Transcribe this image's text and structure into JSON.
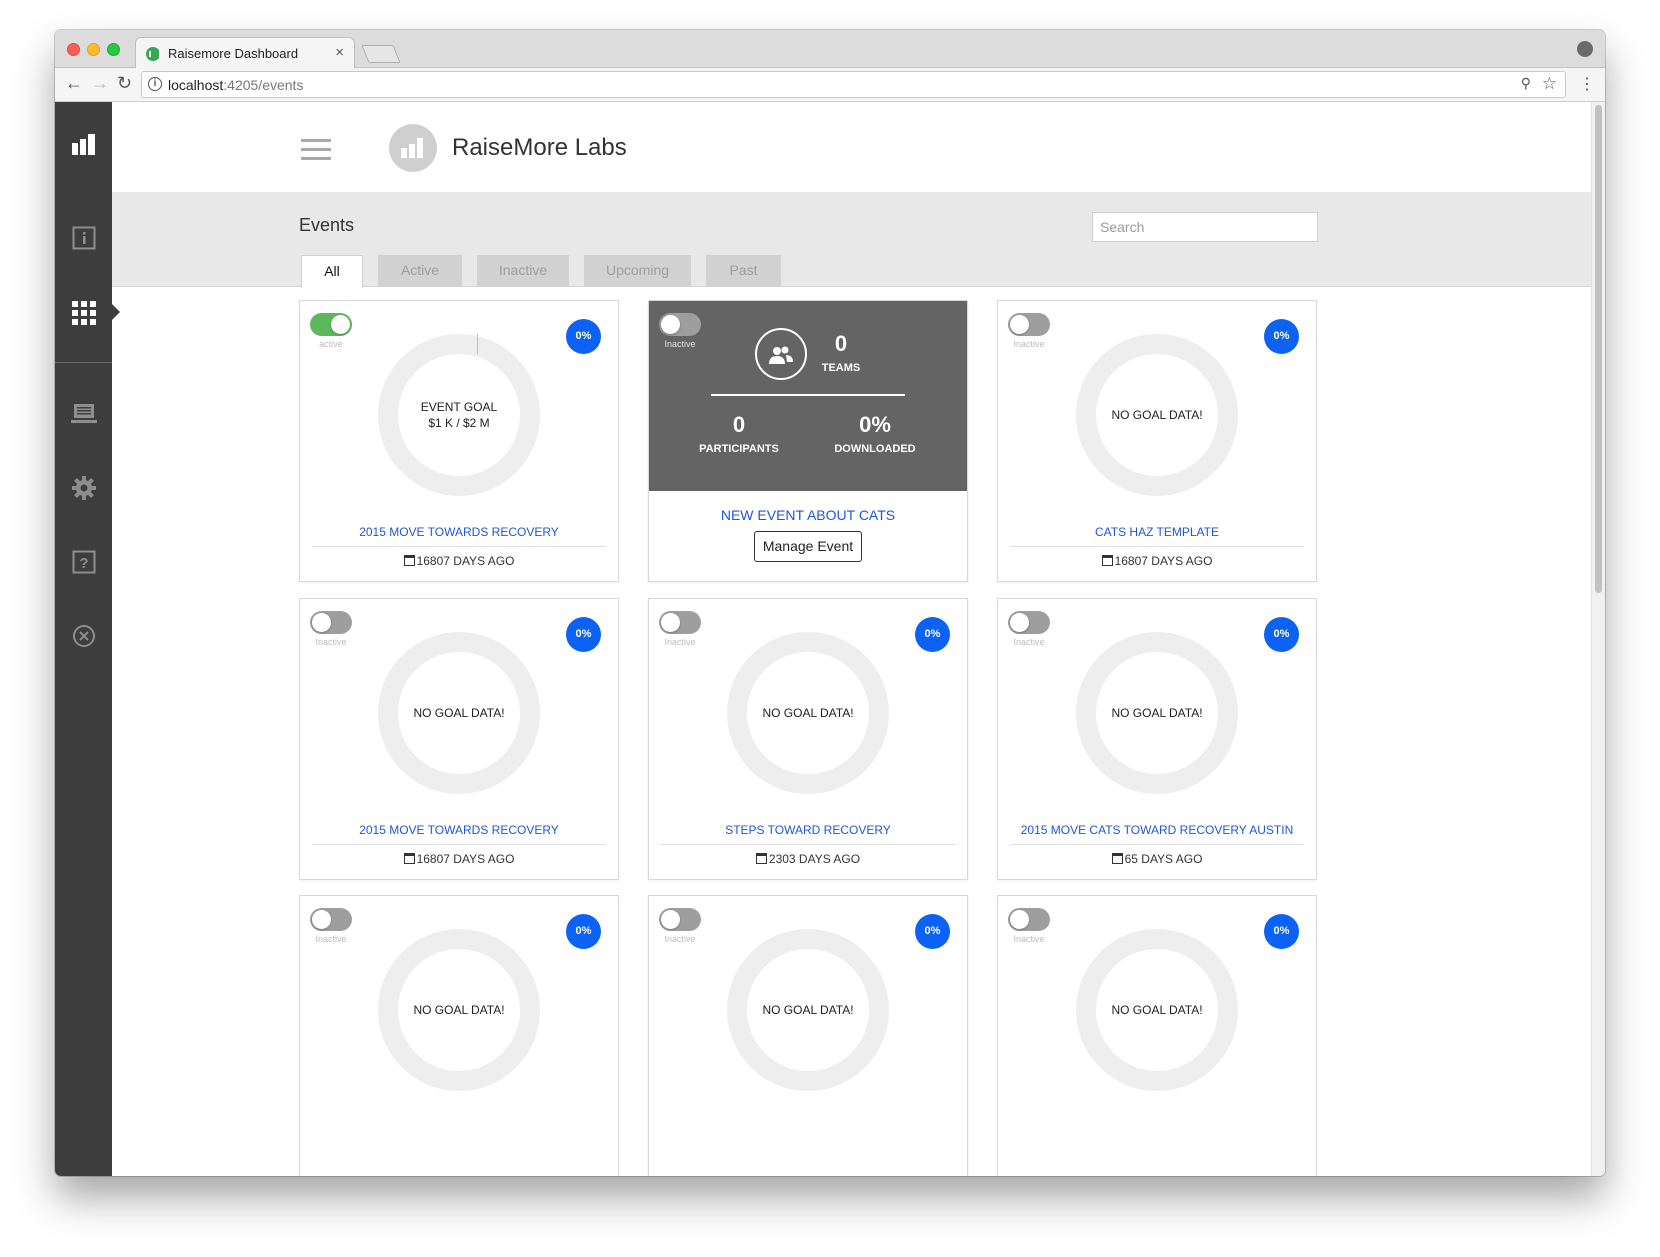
{
  "browser": {
    "tab_title": "Raisemore Dashboard",
    "tab_close": "×",
    "url_host": "localhost",
    "url_path": ":4205/events"
  },
  "header": {
    "brand": "RaiseMore Labs"
  },
  "page": {
    "title": "Events",
    "search_placeholder": "Search"
  },
  "filter_tabs": [
    "All",
    "Active",
    "Inactive",
    "Upcoming",
    "Past"
  ],
  "sidebar_icons": [
    "bar-chart-icon",
    "info-icon",
    "apps-grid-icon",
    "laptop-icon",
    "gear-icon",
    "help-icon",
    "close-circle-icon"
  ],
  "featured": {
    "teams_num": "0",
    "teams_label": "TEAMS",
    "participants_num": "0",
    "participants_label": "PARTICIPANTS",
    "downloaded_num": "0%",
    "downloaded_label": "DOWNLOADED",
    "event_name": "NEW EVENT ABOUT CATS",
    "manage_label": "Manage Event",
    "status": "Inactive"
  },
  "cards": [
    {
      "status": "active",
      "badge": "0%",
      "goal_line1": "EVENT GOAL",
      "goal_line2": "$1 K / $2 M",
      "name": "2015 MOVE TOWARDS RECOVERY",
      "days": "16807 DAYS AGO",
      "progress": 0.0005
    },
    {
      "status": "Inactive",
      "badge": "0%",
      "goal_line1": "NO GOAL DATA!",
      "goal_line2": "",
      "name": "CATS HAZ TEMPLATE",
      "days": "16807 DAYS AGO"
    },
    {
      "status": "Inactive",
      "badge": "0%",
      "goal_line1": "NO GOAL DATA!",
      "goal_line2": "",
      "name": "2015 MOVE TOWARDS RECOVERY",
      "days": "16807 DAYS AGO"
    },
    {
      "status": "Inactive",
      "badge": "0%",
      "goal_line1": "NO GOAL DATA!",
      "goal_line2": "",
      "name": "STEPS TOWARD RECOVERY",
      "days": "2303 DAYS AGO"
    },
    {
      "status": "Inactive",
      "badge": "0%",
      "goal_line1": "NO GOAL DATA!",
      "goal_line2": "",
      "name": "2015 MOVE CATS TOWARD RECOVERY AUSTIN",
      "days": "65 DAYS AGO"
    },
    {
      "status": "Inactive",
      "badge": "0%",
      "goal_line1": "NO GOAL DATA!",
      "goal_line2": "",
      "name": "",
      "days": ""
    },
    {
      "status": "Inactive",
      "badge": "0%",
      "goal_line1": "NO GOAL DATA!",
      "goal_line2": "",
      "name": "",
      "days": ""
    },
    {
      "status": "Inactive",
      "badge": "0%",
      "goal_line1": "NO GOAL DATA!",
      "goal_line2": "",
      "name": "",
      "days": ""
    }
  ],
  "colors": {
    "sidebar": "#3d3d3d",
    "accent_blue": "#0b62f5",
    "link_blue": "#1f56d8",
    "toggle_on": "#5cb85c",
    "featured_panel": "#646464"
  }
}
